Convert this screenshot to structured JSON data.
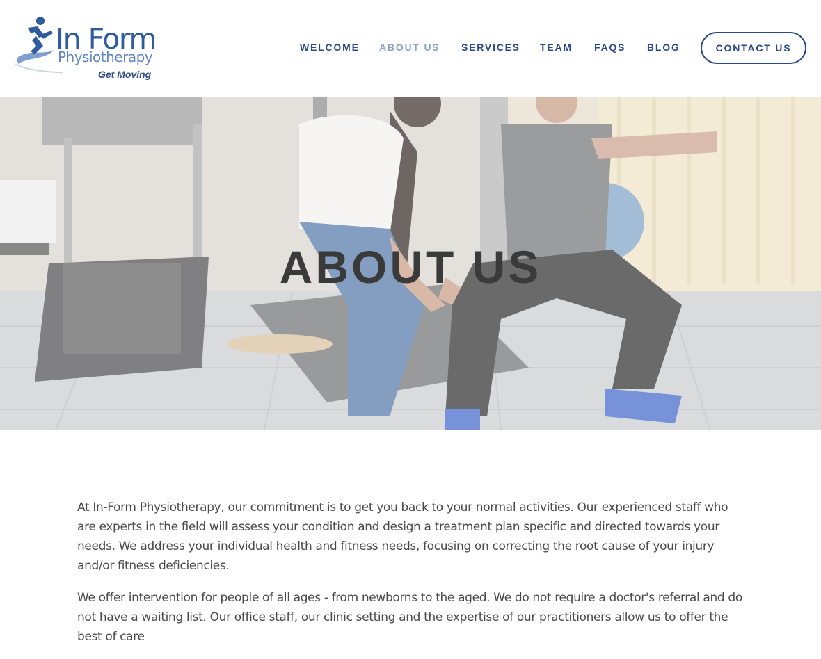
{
  "brand": {
    "name": "In Form",
    "subtitle": "Physiotherapy",
    "tagline": "Get Moving",
    "primary_color": "#2a4a87",
    "logo_icon": "running-figure-icon"
  },
  "nav": {
    "items": [
      {
        "label": "WELCOME",
        "active": false
      },
      {
        "label": "ABOUT US",
        "active": true
      },
      {
        "label": "SERVICES",
        "active": false
      },
      {
        "label": "TEAM",
        "active": false
      },
      {
        "label": "FAQS",
        "active": false
      },
      {
        "label": "BLOG",
        "active": false
      }
    ],
    "contact_label": "CONTACT US"
  },
  "hero": {
    "title": "ABOUT US",
    "image": "physiotherapist-assisting-squat-photo"
  },
  "content": {
    "paragraphs": [
      "At In-Form Physiotherapy, our commitment is to get you back to your normal activities. Our experienced staff who are experts in the field will assess your condition and design a treatment plan specific and directed towards your needs. We address your individual health and fitness needs, focusing on correcting the root cause of your injury and/or fitness deficiencies.",
      "We offer intervention for people of all ages - from newborns to the aged. We do not require a doctor's referral and do not have a waiting list. Our office staff, our clinic setting and the expertise of our practitioners allow us to offer the best of care"
    ]
  }
}
